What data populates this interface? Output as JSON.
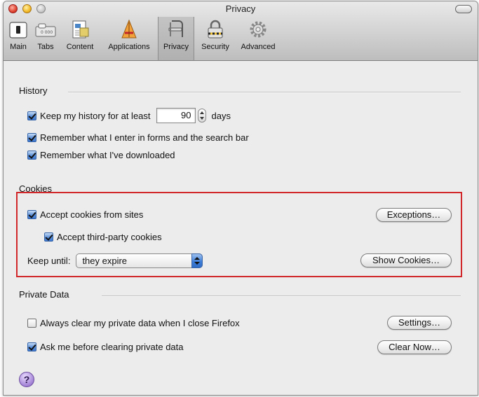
{
  "window": {
    "title": "Privacy"
  },
  "toolbar": {
    "items": [
      {
        "label": "Main",
        "icon": "switch-icon"
      },
      {
        "label": "Tabs",
        "icon": "tabs-icon"
      },
      {
        "label": "Content",
        "icon": "content-icon"
      },
      {
        "label": "Applications",
        "icon": "applications-icon"
      },
      {
        "label": "Privacy",
        "icon": "key-icon",
        "selected": true
      },
      {
        "label": "Security",
        "icon": "lock-icon"
      },
      {
        "label": "Advanced",
        "icon": "gear-icon"
      }
    ]
  },
  "history": {
    "heading": "History",
    "keep_history_label": "Keep my history for at least",
    "keep_history_checked": true,
    "days_value": "90",
    "days_label": "days",
    "remember_forms_label": "Remember what I enter in forms and the search bar",
    "remember_forms_checked": true,
    "remember_downloads_label": "Remember what I've downloaded",
    "remember_downloads_checked": true
  },
  "cookies": {
    "heading": "Cookies",
    "accept_label": "Accept cookies from sites",
    "accept_checked": true,
    "exceptions_button": "Exceptions…",
    "third_party_label": "Accept third-party cookies",
    "third_party_checked": true,
    "keep_until_label": "Keep until:",
    "keep_until_value": "they expire",
    "show_cookies_button": "Show Cookies…",
    "highlight_color": "#d1262a"
  },
  "private_data": {
    "heading": "Private Data",
    "always_clear_label": "Always clear my private data when I close Firefox",
    "always_clear_checked": false,
    "settings_button": "Settings…",
    "ask_before_label": "Ask me before clearing private data",
    "ask_before_checked": true,
    "clear_now_button": "Clear Now…"
  },
  "help": {
    "glyph": "?"
  }
}
